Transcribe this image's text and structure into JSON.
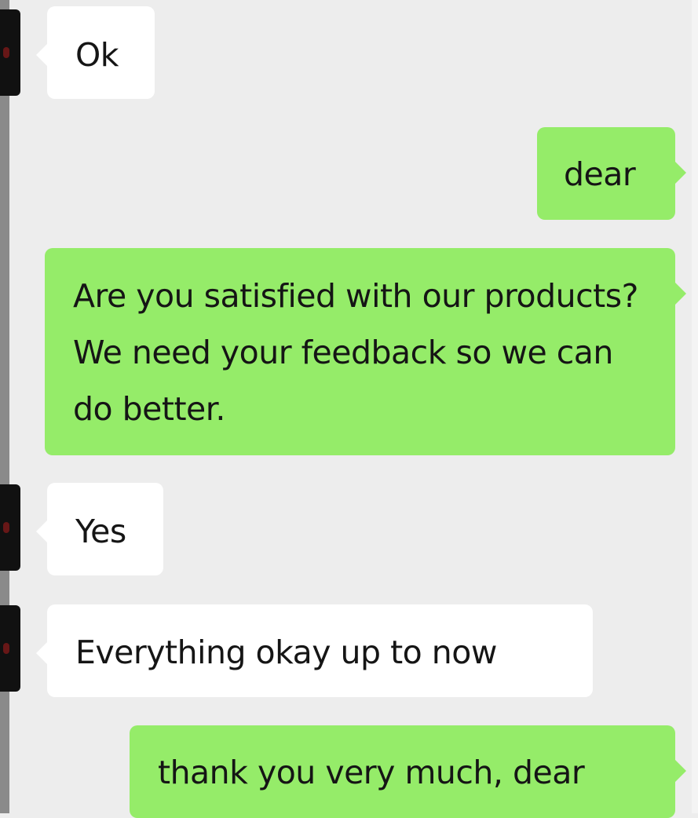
{
  "chat": {
    "messages": [
      {
        "sender": "contact",
        "text": "Ok"
      },
      {
        "sender": "me",
        "text": "dear"
      },
      {
        "sender": "me",
        "text": "Are you satisfied with our products?  We need your feedback so we can do better."
      },
      {
        "sender": "contact",
        "text": "Yes"
      },
      {
        "sender": "contact",
        "text": "Everything okay up to now"
      },
      {
        "sender": "me",
        "text": "thank you very much, dear"
      }
    ]
  },
  "colors": {
    "background": "#ededed",
    "incoming_bubble": "#ffffff",
    "outgoing_bubble": "#95ec69",
    "text": "#151515"
  }
}
